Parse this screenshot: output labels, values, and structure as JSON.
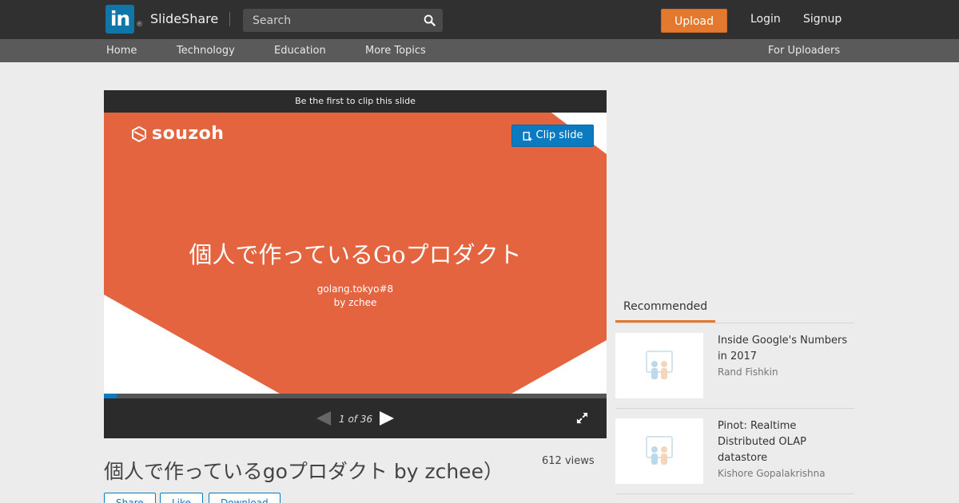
{
  "header": {
    "logo_mark": "in",
    "logo_registered": "®",
    "logo_text": "SlideShare",
    "search_placeholder": "Search",
    "search_icon": "search-icon",
    "upload_label": "Upload",
    "login_label": "Login",
    "signup_label": "Signup"
  },
  "subnav": {
    "items": [
      "Home",
      "Technology",
      "Education",
      "More Topics"
    ],
    "for_uploaders": "For Uploaders"
  },
  "player": {
    "clip_banner": "Be the first to clip this slide",
    "clip_button": "Clip slide",
    "slide": {
      "logo_text": "souzoh",
      "title": "個人で作っているGoプロダクト",
      "subtitle_line1": "golang.tokyo#8",
      "subtitle_line2": "by zchee"
    },
    "current_page": 1,
    "total_pages": 36,
    "page_label": "1 of 36",
    "colors": {
      "slide_orange": "#e4643f",
      "accent_blue": "#0b7bc1"
    }
  },
  "deck": {
    "title": "個人で作っているgoプロダクト by zchee） ",
    "views": "612 views",
    "actions": [
      "Share",
      "Like",
      "Download"
    ]
  },
  "recommended": {
    "tab_label": "Recommended",
    "items": [
      {
        "title": "Inside Google's Numbers in 2017",
        "author": "Rand Fishkin"
      },
      {
        "title": "Pinot: Realtime Distributed OLAP datastore",
        "author": "Kishore Gopalakrishna"
      }
    ]
  }
}
